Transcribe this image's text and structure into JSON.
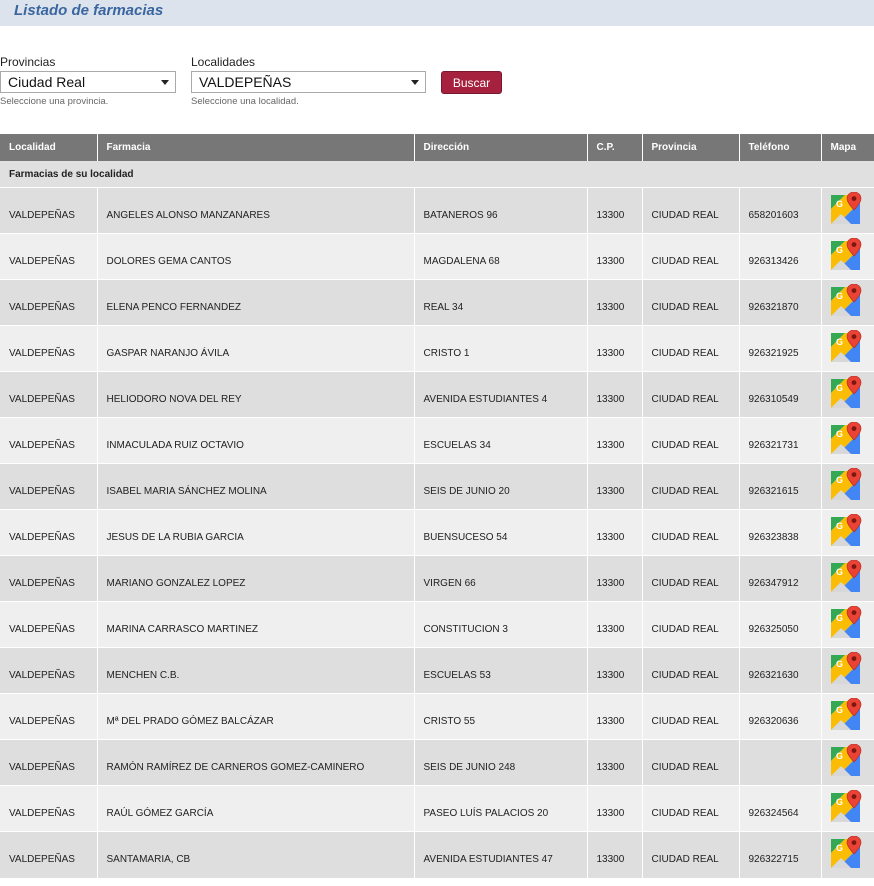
{
  "page": {
    "title": "Listado de farmacias"
  },
  "filters": {
    "provincias": {
      "label": "Provincias",
      "value": "Ciudad Real",
      "hint": "Seleccione una provincia."
    },
    "localidades": {
      "label": "Localidades",
      "value": "VALDEPEÑAS",
      "hint": "Seleccione una localidad."
    },
    "search_label": "Buscar"
  },
  "table": {
    "headers": [
      "Localidad",
      "Farmacia",
      "Dirección",
      "C.P.",
      "Provincia",
      "Teléfono",
      "Mapa"
    ],
    "group_label": "Farmacias de su localidad",
    "rows": [
      [
        "VALDEPEÑAS",
        "ANGELES ALONSO MANZANARES",
        "BATANEROS 96",
        "13300",
        "CIUDAD REAL",
        "658201603"
      ],
      [
        "VALDEPEÑAS",
        "DOLORES GEMA CANTOS",
        "MAGDALENA 68",
        "13300",
        "CIUDAD REAL",
        "926313426"
      ],
      [
        "VALDEPEÑAS",
        "ELENA PENCO FERNANDEZ",
        "REAL 34",
        "13300",
        "CIUDAD REAL",
        "926321870"
      ],
      [
        "VALDEPEÑAS",
        "GASPAR NARANJO ÁVILA",
        "CRISTO 1",
        "13300",
        "CIUDAD REAL",
        "926321925"
      ],
      [
        "VALDEPEÑAS",
        "HELIODORO NOVA DEL REY",
        "AVENIDA ESTUDIANTES 4",
        "13300",
        "CIUDAD REAL",
        "926310549"
      ],
      [
        "VALDEPEÑAS",
        "INMACULADA RUIZ OCTAVIO",
        "ESCUELAS 34",
        "13300",
        "CIUDAD REAL",
        "926321731"
      ],
      [
        "VALDEPEÑAS",
        "ISABEL MARIA SÁNCHEZ MOLINA",
        "SEIS DE JUNIO 20",
        "13300",
        "CIUDAD REAL",
        "926321615"
      ],
      [
        "VALDEPEÑAS",
        "JESUS DE LA RUBIA GARCIA",
        "BUENSUCESO 54",
        "13300",
        "CIUDAD REAL",
        "926323838"
      ],
      [
        "VALDEPEÑAS",
        "MARIANO GONZALEZ LOPEZ",
        "VIRGEN 66",
        "13300",
        "CIUDAD REAL",
        "926347912"
      ],
      [
        "VALDEPEÑAS",
        "MARINA CARRASCO MARTINEZ",
        "CONSTITUCION 3",
        "13300",
        "CIUDAD REAL",
        "926325050"
      ],
      [
        "VALDEPEÑAS",
        "MENCHEN C.B.",
        "ESCUELAS 53",
        "13300",
        "CIUDAD REAL",
        "926321630"
      ],
      [
        "VALDEPEÑAS",
        "Mª DEL PRADO GÓMEZ BALCÁZAR",
        "CRISTO 55",
        "13300",
        "CIUDAD REAL",
        "926320636"
      ],
      [
        "VALDEPEÑAS",
        "RAMÓN RAMÍREZ DE CARNEROS GOMEZ-CAMINERO",
        "SEIS DE JUNIO 248",
        "13300",
        "CIUDAD REAL",
        ""
      ],
      [
        "VALDEPEÑAS",
        "RAÚL GÓMEZ GARCÍA",
        "PASEO LUÍS PALACIOS 20",
        "13300",
        "CIUDAD REAL",
        "926324564"
      ],
      [
        "VALDEPEÑAS",
        "SANTAMARIA, CB",
        "AVENIDA ESTUDIANTES 47",
        "13300",
        "CIUDAD REAL",
        "926322715"
      ]
    ],
    "map_icon": "google-maps-icon"
  },
  "colors": {
    "title_bar": "#dde3ec",
    "title_text": "#3a66a0",
    "button": "#a6213e",
    "header": "#777777",
    "row_odd": "#efefef",
    "row_even": "#dedede"
  }
}
